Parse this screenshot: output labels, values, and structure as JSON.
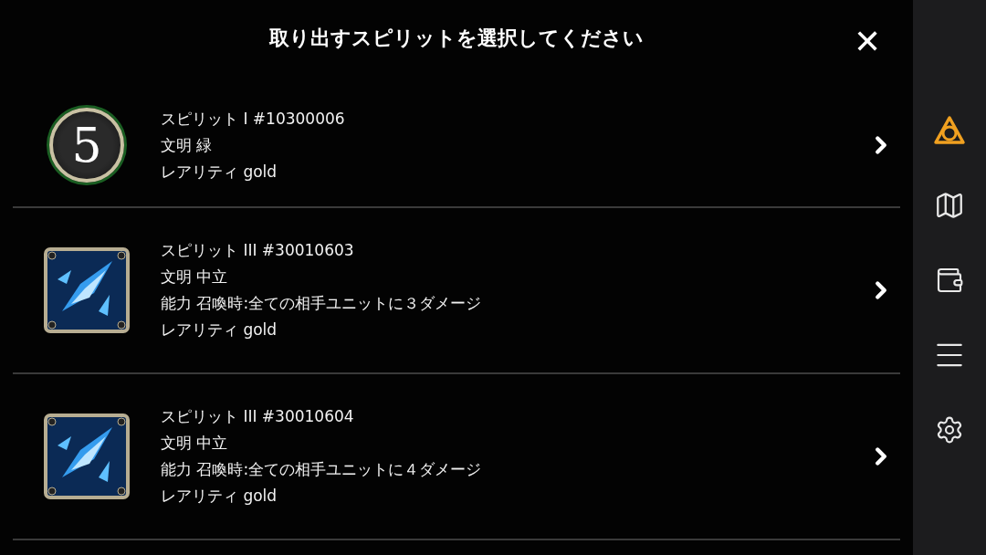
{
  "dialog": {
    "title": "取り出すスピリットを選択してください",
    "close": "✕"
  },
  "spirits": [
    {
      "kind": "badge",
      "badge": "5",
      "lines": [
        "スピリット I #10300006",
        "文明 緑",
        "レアリティ gold"
      ]
    },
    {
      "kind": "artwork",
      "lines": [
        "スピリット III #30010603",
        "文明 中立",
        "能力 召喚時:全ての相手ユニットに３ダメージ",
        "レアリティ gold"
      ]
    },
    {
      "kind": "artwork",
      "lines": [
        "スピリット III #30010604",
        "文明 中立",
        "能力 召喚時:全ての相手ユニットに４ダメージ",
        "レアリティ gold"
      ]
    }
  ],
  "sidebar": {
    "items": [
      {
        "kind": "home",
        "selected": true
      },
      {
        "kind": "map",
        "selected": false
      },
      {
        "kind": "wallet",
        "selected": false
      },
      {
        "kind": "menu",
        "selected": false
      },
      {
        "kind": "settings",
        "selected": false
      }
    ]
  }
}
